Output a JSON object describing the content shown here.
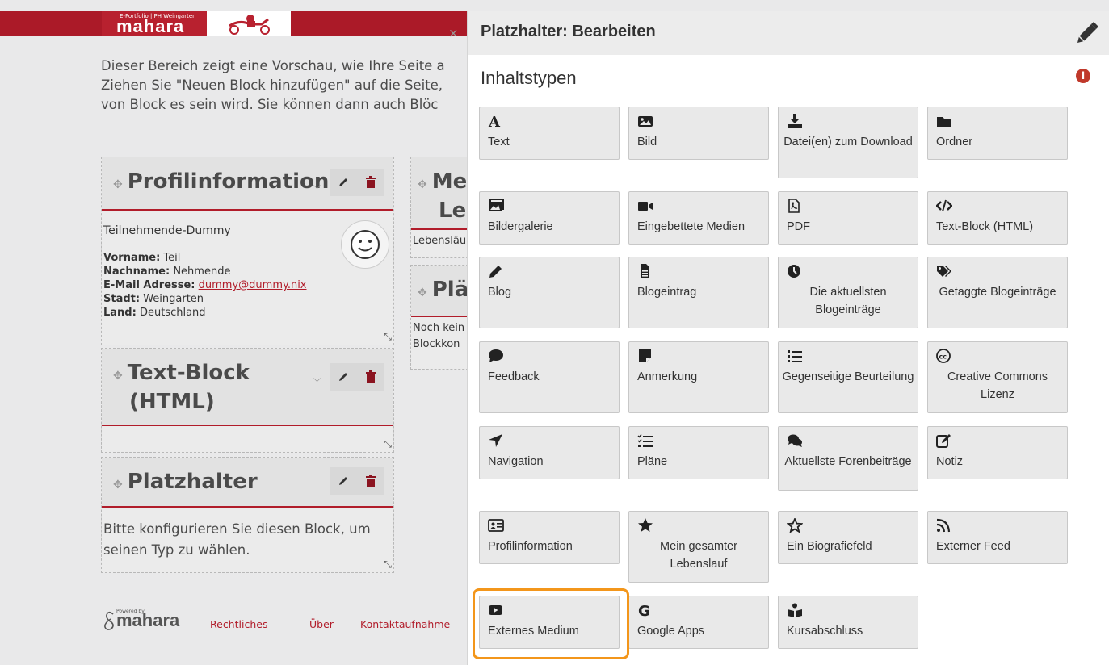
{
  "header": {
    "logo_small": "E-Portfolio | PH Weingarten",
    "logo_text": "mahara"
  },
  "intro": [
    "Dieser Bereich zeigt eine Vorschau, wie Ihre Seite a",
    "Ziehen Sie \"Neuen Block hinzufügen\" auf die Seite,",
    "von Block es sein wird. Sie können dann auch Blöc"
  ],
  "blocks": {
    "profile": {
      "title": "Profilinformation",
      "name": "Teilnehmende-Dummy",
      "rows": [
        {
          "label": "Vorname:",
          "value": " Teil"
        },
        {
          "label": "Nachname:",
          "value": " Nehmende"
        },
        {
          "label": "E-Mail Adresse:",
          "value": "dummy@dummy.nix"
        },
        {
          "label": "Stadt:",
          "value": " Weingarten"
        },
        {
          "label": "Land:",
          "value": " Deutschland"
        }
      ]
    },
    "htmlblock": {
      "title_line1": "Text-Block",
      "title_line2": "(HTML)"
    },
    "placeholder": {
      "title": "Platzhalter",
      "text_line1": "Bitte konfigurieren Sie diesen Block, um",
      "text_line2": "seinen Typ zu wählen."
    },
    "resume": {
      "title_line1": "Me",
      "title_line2": "Le",
      "text": "Lebensläu"
    },
    "plans": {
      "title": "Plä",
      "text_line1": "Noch kein",
      "text_line2": "Blockkon"
    }
  },
  "footer": {
    "powered": "Powered by",
    "logo": "mahara",
    "links": [
      "Rechtliches",
      "Über",
      "Kontaktaufnahme"
    ]
  },
  "panel": {
    "close": "×",
    "title": "Platzhalter: Bearbeiten",
    "section": "Inhaltstypen",
    "info": "i"
  },
  "tiles": [
    {
      "label": "Text",
      "icon": "text-icon",
      "center": false
    },
    {
      "label": "Bild",
      "icon": "image-icon",
      "center": false
    },
    {
      "label": "Datei(en) zum Download",
      "icon": "download-icon",
      "center": true
    },
    {
      "label": "Ordner",
      "icon": "folder-icon",
      "center": false
    },
    {
      "label": "Bildergalerie",
      "icon": "gallery-icon",
      "center": false
    },
    {
      "label": "Eingebettete Medien",
      "icon": "video-icon",
      "center": false
    },
    {
      "label": "PDF",
      "icon": "pdf-icon",
      "center": false
    },
    {
      "label": "Text-Block (HTML)",
      "icon": "code-icon",
      "center": false
    },
    {
      "label": "Blog",
      "icon": "pencil-icon",
      "center": false
    },
    {
      "label": "Blogeintrag",
      "icon": "file-icon",
      "center": false
    },
    {
      "label": "Die aktuellsten Blogeinträge",
      "icon": "clock-icon",
      "center": true
    },
    {
      "label": "Getaggte Blogeinträge",
      "icon": "tags-icon",
      "center": true
    },
    {
      "label": "Feedback",
      "icon": "comment-icon",
      "center": false
    },
    {
      "label": "Anmerkung",
      "icon": "note-icon",
      "center": false
    },
    {
      "label": "Gegenseitige Beurteilung",
      "icon": "list-icon",
      "center": true
    },
    {
      "label": "Creative Commons Lizenz",
      "icon": "cc-icon",
      "center": true
    },
    {
      "label": "Navigation",
      "icon": "navigation-icon",
      "center": false
    },
    {
      "label": "Pläne",
      "icon": "checklist-icon",
      "center": false
    },
    {
      "label": "Aktuellste Forenbeiträge",
      "icon": "comments-icon",
      "center": true
    },
    {
      "label": "Notiz",
      "icon": "edit-icon",
      "center": false
    },
    {
      "label": "Profilinformation",
      "icon": "id-card-icon",
      "center": false
    },
    {
      "label": "Mein gesamter Lebenslauf",
      "icon": "star-icon",
      "center": true
    },
    {
      "label": "Ein Biografiefeld",
      "icon": "star-outline-icon",
      "center": false
    },
    {
      "label": "Externer Feed",
      "icon": "rss-icon",
      "center": false
    },
    {
      "label": "Externes Medium",
      "icon": "youtube-icon",
      "center": false
    },
    {
      "label": "Google Apps",
      "icon": "google-icon",
      "center": false
    },
    {
      "label": "Kursabschluss",
      "icon": "graduation-icon",
      "center": false
    }
  ],
  "colors": {
    "brand_red": "#ab1a28",
    "highlight": "#f3961b"
  }
}
